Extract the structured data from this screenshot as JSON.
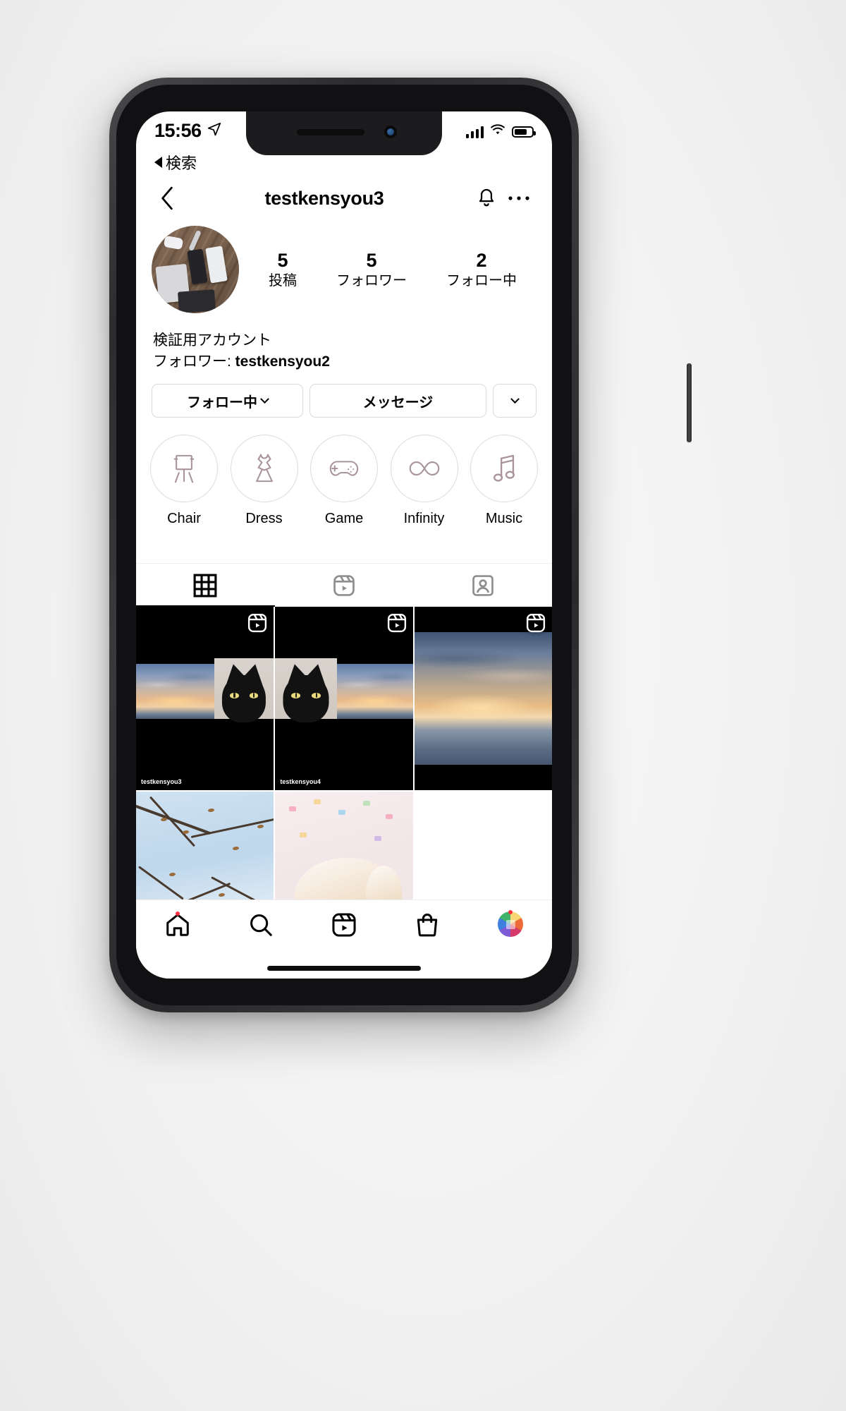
{
  "status_bar": {
    "time": "15:56",
    "location_icon": "location-arrow-icon",
    "signal_icon": "cellular-signal-icon",
    "wifi_icon": "wifi-icon",
    "battery_icon": "battery-icon"
  },
  "back_to_app": {
    "label": "検索",
    "icon": "back-triangle-icon"
  },
  "nav_bar": {
    "back_icon": "chevron-left-icon",
    "title": "testkensyou3",
    "bell_icon": "bell-icon",
    "more_icon": "ellipsis-icon"
  },
  "profile": {
    "avatar_name": "profile-avatar",
    "stats": [
      {
        "number": "5",
        "label": "投稿"
      },
      {
        "number": "5",
        "label": "フォロワー"
      },
      {
        "number": "2",
        "label": "フォロー中"
      }
    ],
    "bio_name": "検証用アカウント",
    "followed_by_prefix": "フォロワー: ",
    "followed_by_user": "testkensyou2"
  },
  "actions": {
    "following_label": "フォロー中",
    "message_label": "メッセージ",
    "suggest_icon": "chevron-down-icon"
  },
  "highlights": [
    {
      "label": "Chair",
      "icon": "easel-icon"
    },
    {
      "label": "Dress",
      "icon": "dress-icon"
    },
    {
      "label": "Game",
      "icon": "gamepad-icon"
    },
    {
      "label": "Infinity",
      "icon": "infinity-icon"
    },
    {
      "label": "Music",
      "icon": "music-note-icon"
    }
  ],
  "tabs": [
    {
      "name": "grid",
      "icon": "grid-icon",
      "active": true
    },
    {
      "name": "reels",
      "icon": "reels-icon",
      "active": false
    },
    {
      "name": "tagged",
      "icon": "tagged-person-icon",
      "active": false
    }
  ],
  "grid_posts": [
    {
      "type": "reel",
      "art": "sunset-cat-collage-a",
      "overlay_user": "testkensyou3",
      "badge": "reels-icon"
    },
    {
      "type": "reel",
      "art": "sunset-cat-collage-b",
      "overlay_user": "testkensyou4",
      "badge": "reels-icon"
    },
    {
      "type": "reel",
      "art": "seascape-sunset",
      "overlay_user": "",
      "badge": "reels-icon"
    },
    {
      "type": "photo",
      "art": "winter-branches-sky",
      "overlay_user": "",
      "badge": ""
    },
    {
      "type": "photo",
      "art": "white-cat-on-chair",
      "overlay_user": "",
      "badge": ""
    }
  ],
  "tab_bar": [
    {
      "name": "home",
      "icon": "home-icon",
      "dot": true
    },
    {
      "name": "search",
      "icon": "search-icon",
      "dot": false
    },
    {
      "name": "reels",
      "icon": "reels-icon",
      "dot": false
    },
    {
      "name": "shop",
      "icon": "shop-bag-icon",
      "dot": false
    },
    {
      "name": "profile",
      "icon": "profile-avatar-icon",
      "dot": true
    }
  ],
  "colors": {
    "accent_red": "#ff3040",
    "border": "#dbdbdb",
    "highlight_icon": "#a9939c",
    "text": "#000000"
  }
}
